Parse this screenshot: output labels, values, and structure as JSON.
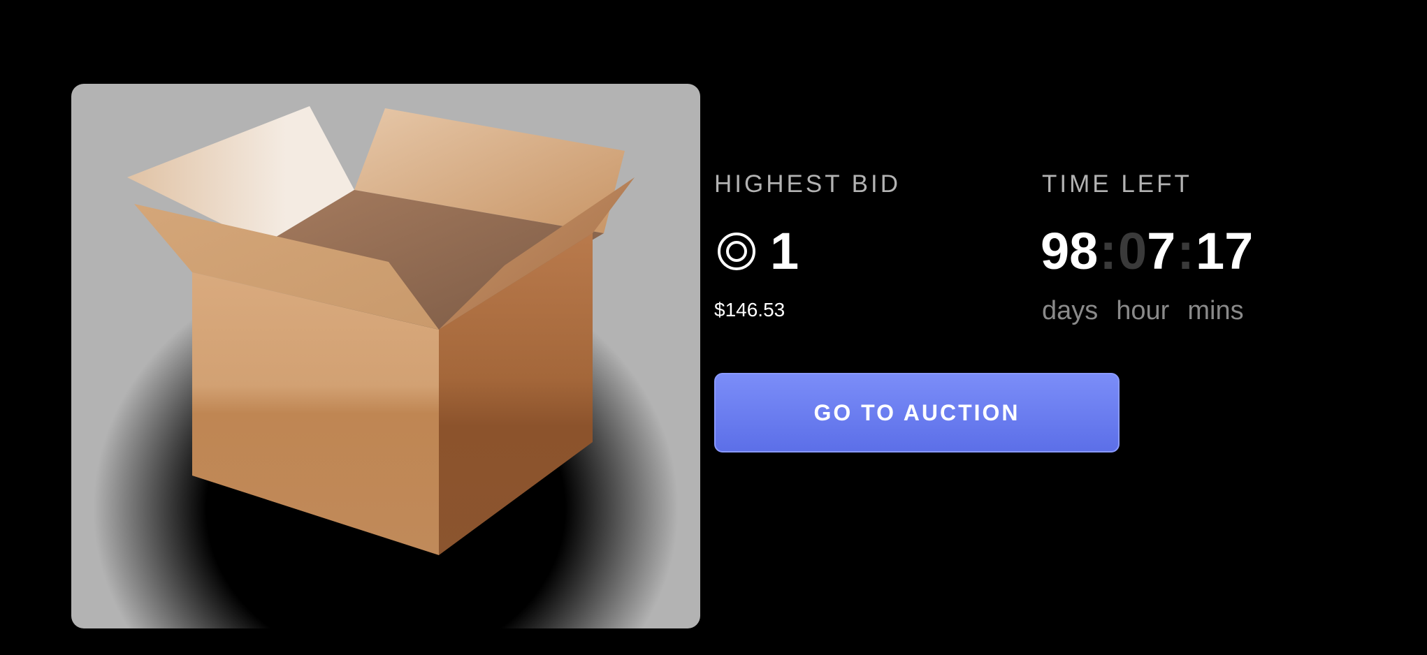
{
  "highest_bid": {
    "label": "HIGHEST BID",
    "value": "1",
    "usd": "$146.53",
    "icon": "coin-icon"
  },
  "time_left": {
    "label": "TIME LEFT",
    "days": "98",
    "hours_dim": "0",
    "hours": "7",
    "mins": "17",
    "separator": ":",
    "units": {
      "days": "days",
      "hour": "hour",
      "mins": "mins"
    }
  },
  "button": {
    "label": "GO TO AUCTION"
  },
  "product": {
    "image": "cardboard-box"
  },
  "colors": {
    "background": "#000000",
    "button": "#6b7df0",
    "label": "#b3b3b3",
    "muted": "#8a8a8a"
  }
}
